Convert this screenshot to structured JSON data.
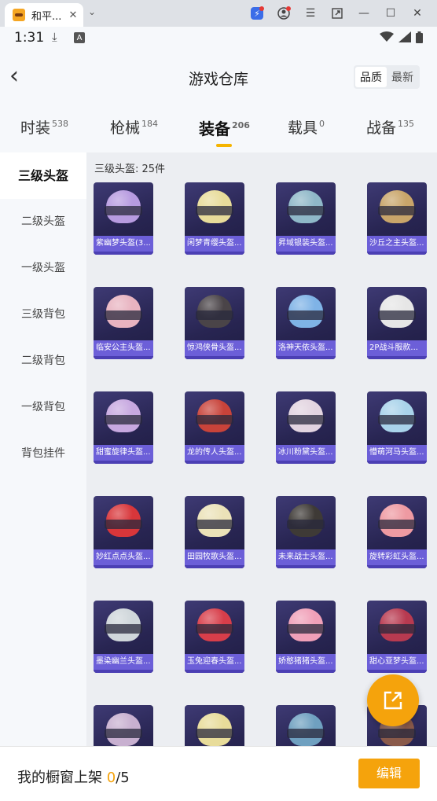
{
  "browser": {
    "tab_title": "和平...",
    "tab_close": "✕",
    "dropdown": "⌄"
  },
  "status": {
    "time": "1:31",
    "download_icon": "download-icon",
    "a_icon_text": "A"
  },
  "header": {
    "back_glyph": "‹",
    "title": "游戏仓库",
    "sort_options": [
      "品质",
      "最新"
    ]
  },
  "category_tabs": [
    {
      "label": "时装",
      "count": "538"
    },
    {
      "label": "枪械",
      "count": "184"
    },
    {
      "label": "装备",
      "count": "206"
    },
    {
      "label": "载具",
      "count": "0"
    },
    {
      "label": "战备",
      "count": "135"
    }
  ],
  "sidebar": [
    "三级头盔",
    "二级头盔",
    "一级头盔",
    "三级背包",
    "二级背包",
    "一级背包",
    "背包挂件"
  ],
  "content": {
    "heading": "三级头盔: 25件",
    "items": [
      {
        "name": "紫幽梦头盔(3...",
        "color": "#b79be0"
      },
      {
        "name": "闲梦青缨头盔...",
        "color": "#e8dc9a"
      },
      {
        "name": "昇域银装头盔...",
        "color": "#8fb8c8"
      },
      {
        "name": "沙丘之主头盔...",
        "color": "#c9a56a"
      },
      {
        "name": "临安公主头盔...",
        "color": "#e8b3c0"
      },
      {
        "name": "惊鸿侠骨头盔...",
        "color": "#4a4448"
      },
      {
        "name": "洛神天依头盔...",
        "color": "#7fb3e6"
      },
      {
        "name": "2P战斗服款...",
        "color": "#e6e6e6"
      },
      {
        "name": "甜蜜旋律头盔...",
        "color": "#c7a8e0"
      },
      {
        "name": "龙的传人头盔...",
        "color": "#c8433a"
      },
      {
        "name": "冰川粉黛头盔...",
        "color": "#e2d4e0"
      },
      {
        "name": "懵萌河马头盔...",
        "color": "#a9d3ea"
      },
      {
        "name": "妙红点点头盔...",
        "color": "#d8363a"
      },
      {
        "name": "田园牧歌头盔...",
        "color": "#ebe2b8"
      },
      {
        "name": "未来战士头盔...",
        "color": "#3e3a36"
      },
      {
        "name": "旋转彩虹头盔...",
        "color": "#ee9aa2"
      },
      {
        "name": "墨染幽兰头盔...",
        "color": "#cfd6da"
      },
      {
        "name": "玉兔迎春头盔...",
        "color": "#d83e4a"
      },
      {
        "name": "娇憨猪猪头盔...",
        "color": "#f0a0b8"
      },
      {
        "name": "甜心亚梦头盔...",
        "color": "#b83a50"
      },
      {
        "name": "",
        "color": "#c8b0d0"
      },
      {
        "name": "",
        "color": "#e8dc9a"
      },
      {
        "name": "",
        "color": "#6fa0c0"
      },
      {
        "name": "",
        "color": "#8a5a4a"
      }
    ]
  },
  "bottom": {
    "label_prefix": "我的橱窗上架 ",
    "count": "0",
    "label_suffix": "/5",
    "edit_label": "编辑"
  }
}
